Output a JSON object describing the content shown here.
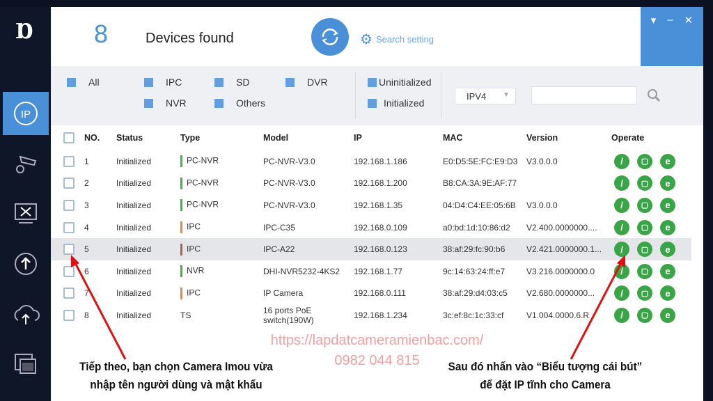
{
  "app": {
    "logo": "IP"
  },
  "sidebar": {
    "items": [
      {
        "icon": "ip-icon",
        "active": true
      },
      {
        "icon": "camera-settings-icon"
      },
      {
        "icon": "tools-icon"
      },
      {
        "icon": "upgrade-icon"
      },
      {
        "icon": "cloud-upload-icon"
      },
      {
        "icon": "windows-icon"
      }
    ]
  },
  "header": {
    "count": "8",
    "title": "Devices found",
    "search_setting": "Search setting"
  },
  "window_controls": {
    "menu": "▾",
    "minimize": "–",
    "close": "✕"
  },
  "filters": {
    "types": [
      "All",
      "IPC",
      "SD",
      "DVR",
      "NVR",
      "Others"
    ],
    "states": [
      "Uninitialized",
      "Initialized"
    ],
    "ip_version": "IPV4",
    "search_value": ""
  },
  "table": {
    "headers": [
      "NO.",
      "Status",
      "Type",
      "Model",
      "IP",
      "MAC",
      "Version",
      "Operate"
    ],
    "rows": [
      {
        "no": "1",
        "status": "Initialized",
        "type": "PC-NVR",
        "type_color": "#3cb44b",
        "model": "PC-NVR-V3.0",
        "ip": "192.168.1.186",
        "mac": "E0:D5:5E:FC:E9:D3",
        "version": "V3.0.0.0"
      },
      {
        "no": "2",
        "status": "Initialized",
        "type": "PC-NVR",
        "type_color": "#3cb44b",
        "model": "PC-NVR-V3.0",
        "ip": "192.168.1.200",
        "mac": "B8:CA:3A:9E:AF:77",
        "version": ""
      },
      {
        "no": "3",
        "status": "Initialized",
        "type": "PC-NVR",
        "type_color": "#3cb44b",
        "model": "PC-NVR-V3.0",
        "ip": "192.168.1.35",
        "mac": "04:D4:C4:EE:05:6B",
        "version": "V3.0.0.0"
      },
      {
        "no": "4",
        "status": "Initialized",
        "type": "IPC",
        "type_color": "#e8883a",
        "model": "IPC-C35",
        "ip": "192.168.0.109",
        "mac": "a0:bd:1d:10:86:d2",
        "version": "V2.400.0000000...."
      },
      {
        "no": "5",
        "status": "Initialized",
        "type": "IPC",
        "type_color": "#a0654a",
        "model": "IPC-A22",
        "ip": "192.168.0.123",
        "mac": "38:af:29:fc:90:b6",
        "version": "V2.421.0000000.1...",
        "selected": true
      },
      {
        "no": "6",
        "status": "Initialized",
        "type": "NVR",
        "type_color": "#3cb44b",
        "model": "DHI-NVR5232-4KS2",
        "ip": "192.168.1.77",
        "mac": "9c:14:63:24:ff:e7",
        "version": "V3.216.0000000.0"
      },
      {
        "no": "7",
        "status": "Initialized",
        "type": "IPC",
        "type_color": "#e8883a",
        "model": "IP Camera",
        "ip": "192.168.0.111",
        "mac": "38:af:29:d4:03:c5",
        "version": "V2.680.0000000..."
      },
      {
        "no": "8",
        "status": "Initialized",
        "type": "TS",
        "type_color": "",
        "model": "16 ports PoE switch(190W)",
        "ip": "192.168.1.234",
        "mac": "3c:ef:8c:1c:33:cf",
        "version": "V1.004.0000.6.R"
      }
    ],
    "operate_icons": [
      "edit-pen-icon",
      "web-icon",
      "e-browser-icon"
    ]
  },
  "overlay": {
    "watermark_url": "https://lapdatcameramienbac.com/",
    "watermark_phone": "0982 044 815",
    "caption_left": [
      "Tiếp theo, bạn chọn Camera Imou vừa",
      "nhập tên người dùng và mật khẩu"
    ],
    "caption_right": [
      "Sau đó nhấn vào “Biểu tượng cái bút”",
      "để đặt IP tĩnh cho Camera"
    ],
    "arrow_color": "#e01010"
  }
}
